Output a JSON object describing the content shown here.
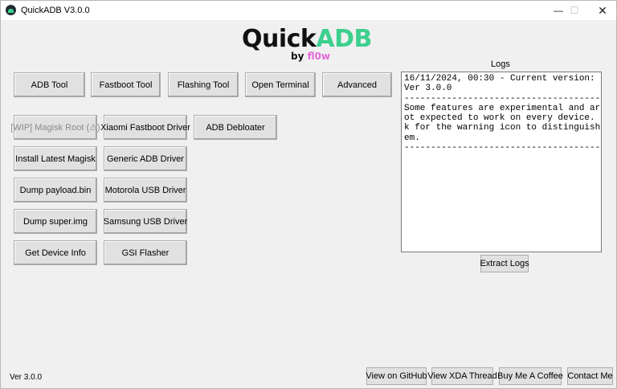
{
  "window": {
    "title": "QuickADB V3.0.0",
    "controls": {
      "minimize": "—",
      "maximize": "☐",
      "close": "✕"
    }
  },
  "logo": {
    "quick": "Quick",
    "adb": "ADB",
    "by": "by ",
    "author": "fl0w"
  },
  "toolbar": [
    "ADB Tool",
    "Fastboot Tool",
    "Flashing Tool",
    "Open Terminal",
    "Advanced"
  ],
  "tools": {
    "magisk_root": "[WIP] Magisk Root (⚠)",
    "xiaomi_fastboot_driver": "Xiaomi Fastboot Driver",
    "adb_debloater": "ADB Debloater",
    "install_magisk": "Install Latest Magisk",
    "generic_adb_driver": "Generic ADB Driver",
    "dump_payload": "Dump payload.bin",
    "motorola_usb_driver": "Motorola USB Driver",
    "dump_super": "Dump super.img",
    "samsung_usb_driver": "Samsung USB Driver",
    "device_info": "Get Device Info",
    "gsi_flasher": "GSI Flasher"
  },
  "logs": {
    "label": "Logs",
    "lines": [
      "16/11/2024, 00:30 - Current version:",
      "Ver 3.0.0",
      "----------------------------------------",
      "Some features are experimental and are n",
      "ot expected to work on every device. Loo",
      "k for the warning icon to distinguish th",
      "em.",
      "----------------------------------------"
    ],
    "extract_button": "Extract Logs"
  },
  "footer": {
    "version": "Ver 3.0.0",
    "links": [
      "View on GitHub",
      "View XDA Thread",
      "Buy Me A Coffee",
      "Contact Me"
    ]
  }
}
